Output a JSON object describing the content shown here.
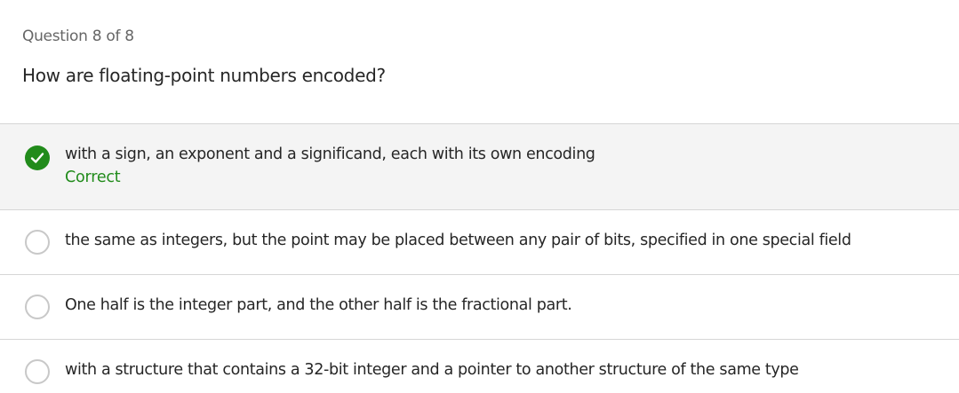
{
  "quiz": {
    "progress_label": "Question 8 of 8",
    "question_text": "How are floating-point numbers encoded?"
  },
  "options": [
    {
      "text": "with a sign, an exponent and a significand, each with its own encoding",
      "selected": true,
      "feedback": "Correct"
    },
    {
      "text": "the same as integers, but the point may be placed between any pair of bits, specified in one special field",
      "selected": false
    },
    {
      "text": "One half is the integer part, and the other half is the fractional part.",
      "selected": false
    },
    {
      "text": "with a structure that contains a 32-bit integer and a pointer to another structure of the same type",
      "selected": false
    }
  ],
  "colors": {
    "correct": "#218b1b",
    "selected_background": "#f4f4f4",
    "divider": "#d6d6d6"
  },
  "icons": {
    "selected_option": "checkmark-icon"
  }
}
